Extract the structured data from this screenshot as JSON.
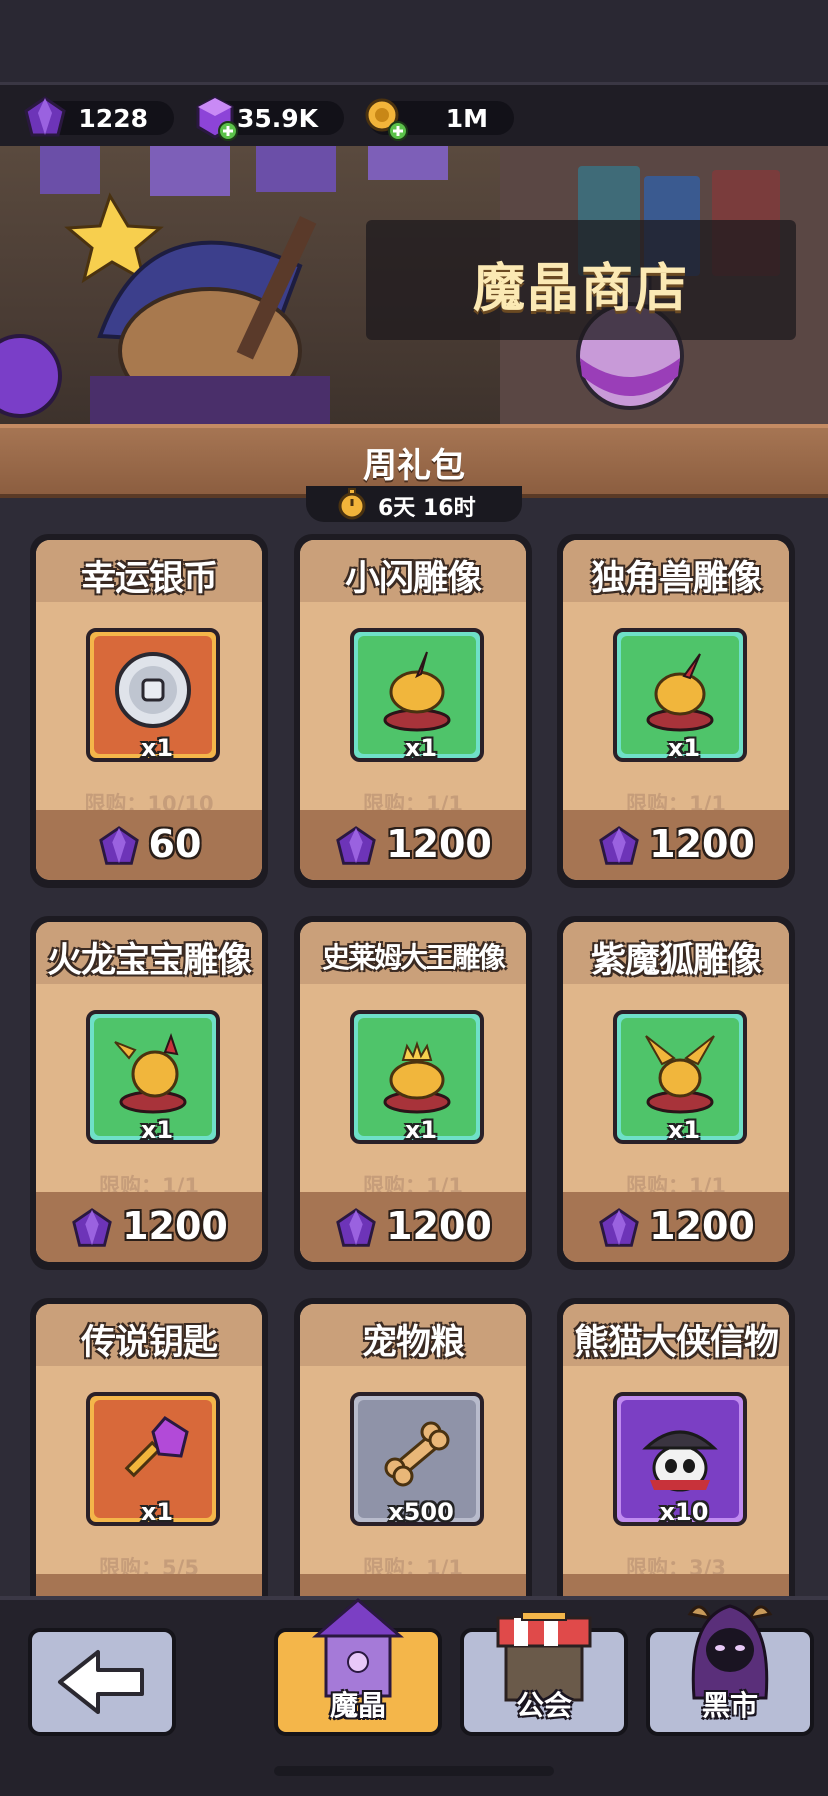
{
  "currencies": [
    {
      "name": "gem",
      "icon": "purple-gem-icon",
      "value": "1228"
    },
    {
      "name": "crystal",
      "icon": "purple-cube-plus-icon",
      "value": "35.9K"
    },
    {
      "name": "gold",
      "icon": "gold-key-plus-icon",
      "value": "1M"
    }
  ],
  "banner": {
    "title": "魔晶商店"
  },
  "section": {
    "title": "周礼包",
    "timer": "6天 16时"
  },
  "items": [
    {
      "name": "幸运银币",
      "qty": "x1",
      "limit": "限购：10/10",
      "price": "60",
      "bg": "orange",
      "icon": "silver-coin-icon"
    },
    {
      "name": "小闪雕像",
      "qty": "x1",
      "limit": "限购：1/1",
      "price": "1200",
      "bg": "green",
      "icon": "spark-statue-icon"
    },
    {
      "name": "独角兽雕像",
      "qty": "x1",
      "limit": "限购：1/1",
      "price": "1200",
      "bg": "green",
      "icon": "unicorn-statue-icon"
    },
    {
      "name": "火龙宝宝雕像",
      "qty": "x1",
      "limit": "限购：1/1",
      "price": "1200",
      "bg": "green",
      "icon": "dragon-statue-icon"
    },
    {
      "name": "史莱姆大王雕像",
      "qty": "x1",
      "limit": "限购：1/1",
      "price": "1200",
      "bg": "green",
      "icon": "slime-king-statue-icon"
    },
    {
      "name": "紫魔狐雕像",
      "qty": "x1",
      "limit": "限购：1/1",
      "price": "1200",
      "bg": "green",
      "icon": "fox-statue-icon"
    },
    {
      "name": "传说钥匙",
      "qty": "x1",
      "limit": "限购：5/5",
      "price": "",
      "bg": "orange",
      "icon": "legend-key-icon"
    },
    {
      "name": "宠物粮",
      "qty": "x500",
      "limit": "限购：1/1",
      "price": "",
      "bg": "grey",
      "icon": "bone-icon"
    },
    {
      "name": "熊猫大侠信物",
      "qty": "x10",
      "limit": "限购：3/3",
      "price": "",
      "bg": "purple",
      "icon": "panda-hero-icon"
    }
  ],
  "nav": [
    {
      "label": "",
      "icon": "back-arrow-icon"
    },
    {
      "label": "魔晶",
      "icon": "magic-tower-icon"
    },
    {
      "label": "公会",
      "icon": "shop-stall-icon"
    },
    {
      "label": "黑市",
      "icon": "hooded-demon-icon"
    }
  ],
  "colors": {
    "accent": "#f4b64a",
    "card": "#e0b68a",
    "gem": "#7b3fc4",
    "green": "#4fc46a",
    "orange": "#d8693a"
  }
}
